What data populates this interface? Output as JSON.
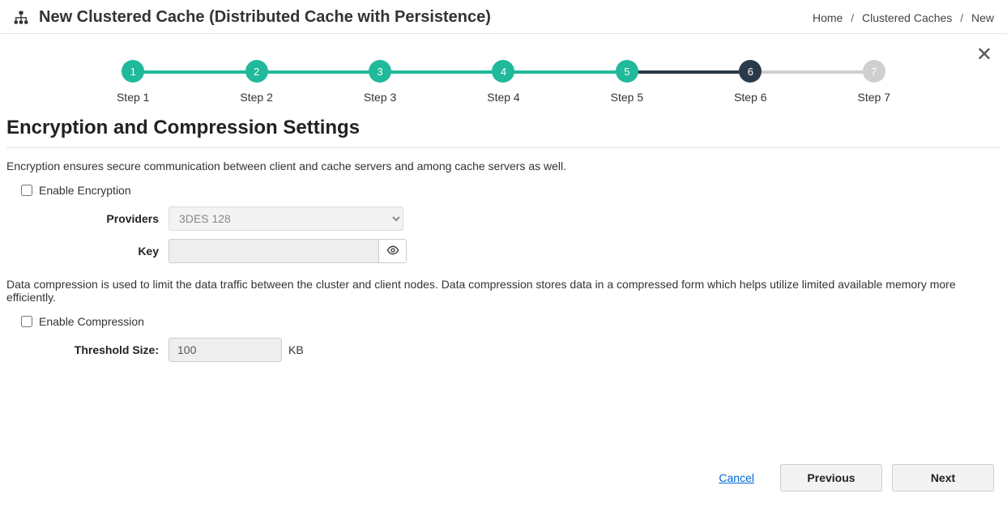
{
  "header": {
    "title": "New Clustered Cache (Distributed Cache with Persistence)",
    "breadcrumb": {
      "home": "Home",
      "mid": "Clustered Caches",
      "last": "New"
    }
  },
  "stepper": {
    "steps": [
      {
        "num": "1",
        "label": "Step 1",
        "circle": "c-done",
        "bar": "b-done"
      },
      {
        "num": "2",
        "label": "Step 2",
        "circle": "c-done",
        "bar": "b-done"
      },
      {
        "num": "3",
        "label": "Step 3",
        "circle": "c-done",
        "bar": "b-done"
      },
      {
        "num": "4",
        "label": "Step 4",
        "circle": "c-done",
        "bar": "b-done"
      },
      {
        "num": "5",
        "label": "Step 5",
        "circle": "c-done",
        "bar": "b-dark"
      },
      {
        "num": "6",
        "label": "Step 6",
        "circle": "c-active",
        "bar": "b-grey"
      },
      {
        "num": "7",
        "label": "Step 7",
        "circle": "c-future",
        "bar": ""
      }
    ]
  },
  "section": {
    "title": "Encryption and Compression Settings"
  },
  "encryption": {
    "desc": "Encryption ensures secure communication between client and cache servers and among cache servers as well.",
    "enable_label": "Enable Encryption",
    "providers_label": "Providers",
    "providers_value": "3DES 128",
    "key_label": "Key",
    "key_value": ""
  },
  "compression": {
    "desc": "Data compression is used to limit the data traffic between the cluster and client nodes. Data compression stores data in a compressed form which helps utilize limited available memory more efficiently.",
    "enable_label": "Enable Compression",
    "threshold_label": "Threshold Size:",
    "threshold_value": "100",
    "threshold_unit": "KB"
  },
  "footer": {
    "cancel": "Cancel",
    "previous": "Previous",
    "next": "Next"
  }
}
